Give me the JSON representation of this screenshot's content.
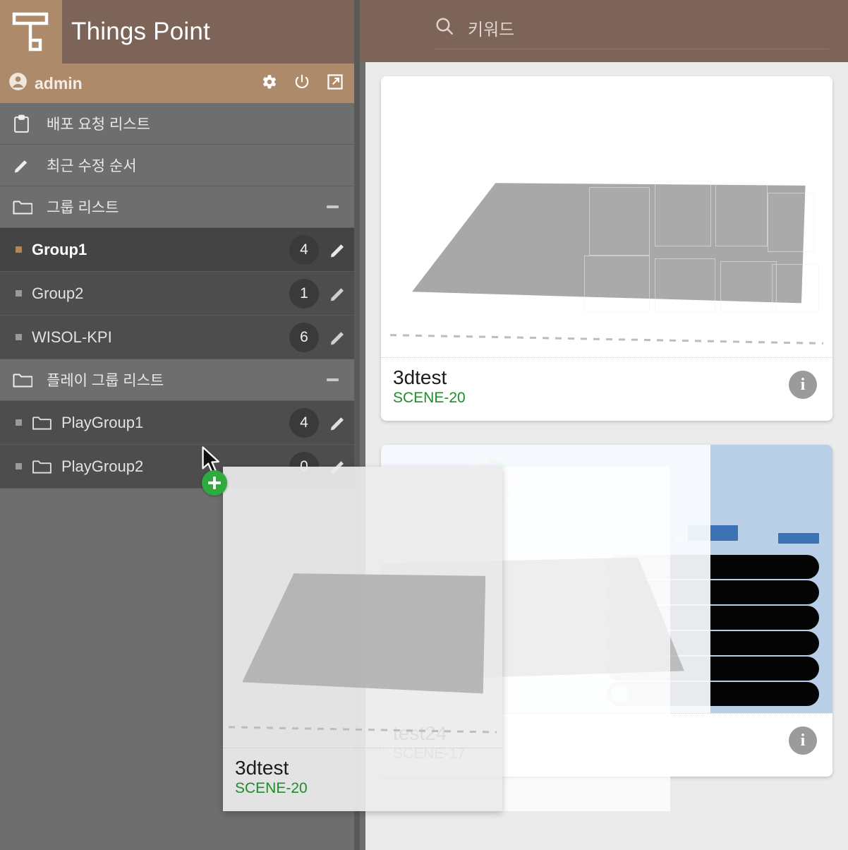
{
  "app": {
    "brand_title": "Things Point",
    "logo_icon": "things-point-t-logo"
  },
  "user_bar": {
    "username": "admin",
    "icons": [
      "account-circle-icon",
      "gear-icon",
      "power-icon",
      "external-link-icon"
    ]
  },
  "search": {
    "icon": "search-icon",
    "placeholder": "키워드",
    "value": ""
  },
  "sidebar": {
    "menu": [
      {
        "label": "배포 요청 리스트",
        "icon": "clipboard-icon"
      },
      {
        "label": "최근 수정 순서",
        "icon": "pencil-icon"
      }
    ],
    "group_list": {
      "label": "그룹 리스트",
      "icon": "folder-icon",
      "collapse_icon": "minus-icon",
      "items": [
        {
          "label": "Group1",
          "count": "4",
          "selected": true,
          "edit_icon": "pencil-icon"
        },
        {
          "label": "Group2",
          "count": "1",
          "selected": false,
          "edit_icon": "pencil-icon"
        },
        {
          "label": "WISOL-KPI",
          "count": "6",
          "selected": false,
          "edit_icon": "pencil-icon"
        }
      ]
    },
    "play_group_list": {
      "label": "플레이 그룹 리스트",
      "icon": "folder-icon",
      "collapse_icon": "minus-icon",
      "items": [
        {
          "label": "PlayGroup1",
          "count": "4",
          "icon": "folder-icon",
          "edit_icon": "pencil-icon"
        },
        {
          "label": "PlayGroup2",
          "count": "0",
          "icon": "folder-icon",
          "edit_icon": "pencil-icon"
        }
      ]
    }
  },
  "content": {
    "cards": [
      {
        "title": "3dtest",
        "scene_id": "SCENE-20",
        "info_icon": "info-icon",
        "thumbnail": "3d-scene-thumbnail"
      },
      {
        "title": "test24",
        "scene_id": "SCENE-17",
        "info_icon": "info-icon",
        "thumbnail": "dashboard-thumbnail"
      }
    ]
  },
  "drag": {
    "cursor_icon": "arrow-cursor-icon",
    "badge_icon": "plus-icon",
    "ghost_card": {
      "title": "3dtest",
      "scene_id": "SCENE-20"
    }
  },
  "colors": {
    "brand_dark": "#7d6459",
    "brand_light": "#ad8a6a",
    "sidebar_bg": "#6e6e6e",
    "row_bg": "#4d4d4d",
    "row_selected_bg": "#444444",
    "accent_bar": "#b08a66",
    "scene_green": "#1e8c2b",
    "drag_badge_green": "#2eaa3e",
    "content_bg": "#ebebeb"
  }
}
